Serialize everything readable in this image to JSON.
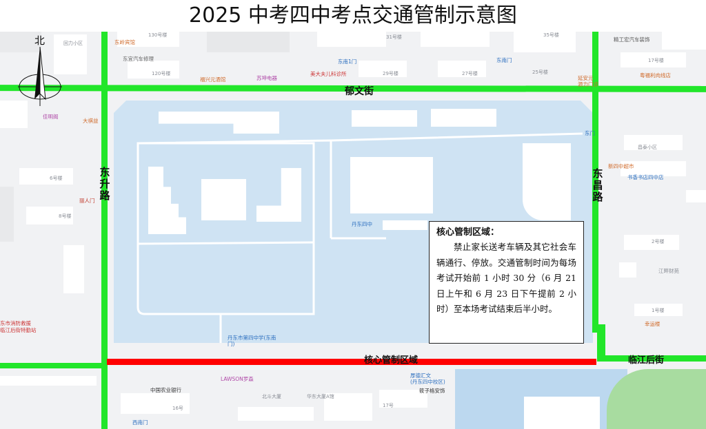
{
  "title": "2025 中考四中考点交通管制示意图",
  "compass": {
    "label": "北",
    "icon": "north-arrow-icon"
  },
  "streets": {
    "top": "郁文街",
    "left": "东升路",
    "right": "东昌路",
    "bottom_right": "临江后街",
    "core_zone": "核心管制区域"
  },
  "info_box": {
    "title": "核心管制区域：",
    "body": "禁止家长送考车辆及其它社会车辆通行、停放。交通管制时间为每场考试开始前 1 小时 30 分（6 月 21 日上午和 6 月 23 日下午提前 2 小时）至本场考试结束后半小时。"
  },
  "colors": {
    "controlled_road": "#22e62a",
    "core_zone_road": "#ff0000",
    "school_area": "#cfe3f3",
    "water": "#bcd8ef",
    "park": "#a8dca0"
  },
  "pois": [
    {
      "text": "东岭宾馆",
      "kind": "orange"
    },
    {
      "text": "东宜汽车修理",
      "kind": "gray"
    },
    {
      "text": "东南1门",
      "kind": "blue"
    },
    {
      "text": "东南门",
      "kind": "blue"
    },
    {
      "text": "福兴元酒馆",
      "kind": "orange"
    },
    {
      "text": "苏坤电器",
      "kind": "magenta"
    },
    {
      "text": "美大夫儿科诊所",
      "kind": "red"
    },
    {
      "text": "延安元",
      "kind": "orange"
    },
    {
      "text": "源力门诊",
      "kind": "orange"
    },
    {
      "text": "精工宏汽车装饰",
      "kind": "gray"
    },
    {
      "text": "粤福利肉线店",
      "kind": "orange"
    },
    {
      "text": "佳明阁",
      "kind": "magenta"
    },
    {
      "text": "大祺益",
      "kind": "orange"
    },
    {
      "text": "东门",
      "kind": "blue"
    },
    {
      "text": "新四中超市",
      "kind": "orange"
    },
    {
      "text": "丹东四中",
      "kind": "blue"
    },
    {
      "text": "丹东市第四中学(东南门)",
      "kind": "blue"
    },
    {
      "text": "东市消防救援",
      "kind": "red"
    },
    {
      "text": "临江后街特勤站",
      "kind": "red"
    },
    {
      "text": "LAWSON罗森",
      "kind": "magenta"
    },
    {
      "text": "中国农业银行",
      "kind": "gray"
    },
    {
      "text": "厚德汇文",
      "kind": "blue"
    },
    {
      "text": "(丹东四中校区)",
      "kind": "blue"
    },
    {
      "text": "幸运楼",
      "kind": "orange"
    },
    {
      "text": "西南门",
      "kind": "blue"
    },
    {
      "text": "江畔财苑",
      "kind": "gray"
    },
    {
      "text": "书香书店四中店",
      "kind": "blue"
    },
    {
      "text": "筱子格安饰",
      "kind": "gray"
    },
    {
      "text": "丽人门",
      "kind": "gray"
    }
  ],
  "building_labels": [
    "130号楼",
    "120号楼",
    "31号楼",
    "29号楼",
    "27号楼",
    "25号楼",
    "35号楼",
    "17号楼",
    "6号楼",
    "8号楼",
    "2号楼",
    "1号楼",
    "16号",
    "17号",
    "北斗大厦",
    "华东大厦A馆",
    "昌泰小区",
    "回力小区"
  ]
}
